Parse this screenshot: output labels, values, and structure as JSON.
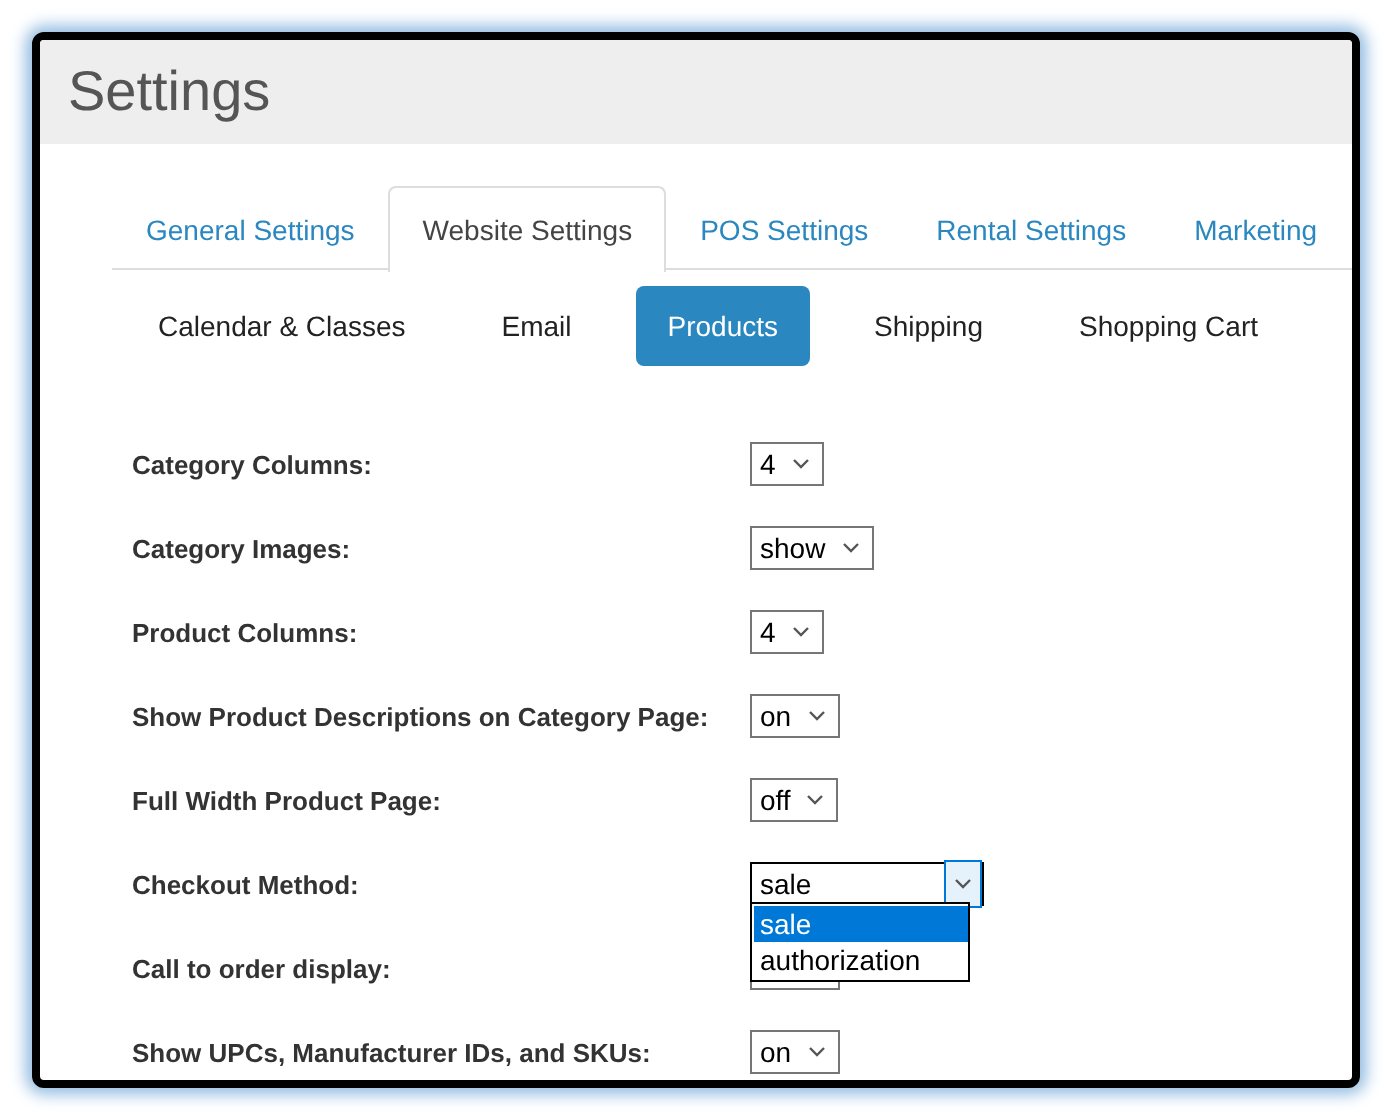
{
  "window": {
    "title": "Settings"
  },
  "tabs": [
    {
      "label": "General Settings",
      "selected": false
    },
    {
      "label": "Website Settings",
      "selected": true
    },
    {
      "label": "POS Settings",
      "selected": false
    },
    {
      "label": "Rental Settings",
      "selected": false
    },
    {
      "label": "Marketing",
      "selected": false
    }
  ],
  "subtabs": [
    {
      "label": "Calendar & Classes",
      "selected": false
    },
    {
      "label": "Email",
      "selected": false
    },
    {
      "label": "Products",
      "selected": true
    },
    {
      "label": "Shipping",
      "selected": false
    },
    {
      "label": "Shopping Cart",
      "selected": false
    }
  ],
  "settings": [
    {
      "label": "Category Columns:",
      "value": "4",
      "open": false
    },
    {
      "label": "Category Images:",
      "value": "show",
      "open": false
    },
    {
      "label": "Product Columns:",
      "value": "4",
      "open": false
    },
    {
      "label": "Show Product Descriptions on Category Page:",
      "value": "on",
      "open": false
    },
    {
      "label": "Full Width Product Page:",
      "value": "off",
      "open": false
    },
    {
      "label": "Checkout Method:",
      "value": "sale",
      "open": true,
      "options": [
        {
          "label": "sale",
          "selected": true
        },
        {
          "label": "authorization",
          "selected": false
        }
      ]
    },
    {
      "label": "Call to order display:",
      "open": false
    },
    {
      "label": "Show UPCs, Manufacturer IDs, and SKUs:",
      "value": "on",
      "open": false
    }
  ]
}
